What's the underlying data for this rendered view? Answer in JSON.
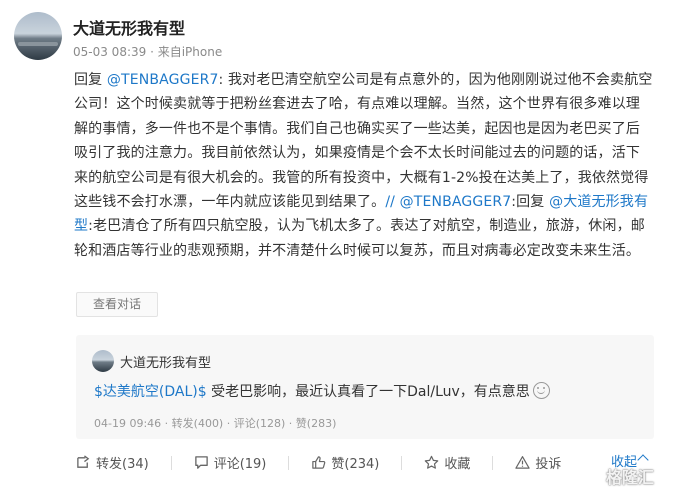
{
  "post": {
    "author": "大道无形我有型",
    "meta": "05-03 08:39 · 来自iPhone",
    "body": {
      "reply_prefix": "回复 ",
      "mention1": "@TENBAGGER7",
      "text1": ": 我对老巴清空航空公司是有点意外的，因为他刚刚说过他不会卖航空公司！这个时候卖就等于把粉丝套进去了哈，有点难以理解。当然，这个世界有很多难以理解的事情，多一件也不是个事情。我们自己也确实买了一些达美，起因也是因为老巴买了后吸引了我的注意力。我目前依然认为，如果疫情是个会不太长时间能过去的问题的话，活下来的航空公司是有很大机会的。我管的所有投资中，大概有1-2%投在达美上了，我依然觉得这些钱不会打水漂，一年内就应该能见到结果了。",
      "mention2": "// @TENBAGGER7",
      "text2": ":回复 ",
      "mention3": "@大道无形我有型",
      "text3": ":老巴清仓了所有四只航空股，认为飞机太多了。表达了对航空，制造业，旅游，休闲，邮轮和酒店等行业的悲观预期，并不清楚什么时候可以复苏，而且对病毒必定改变未来生活。"
    },
    "view_conversation": "查看对话"
  },
  "quote": {
    "author": "大道无形我有型",
    "stock_tag": "$达美航空(DAL)$",
    "text": " 受老巴影响，最近认真看了一下Dal/Luv，有点意思",
    "emoji_icon": "smile-icon",
    "meta": "04-19 09:46 · 转发(400) · 评论(128) · 赞(283)"
  },
  "actions": {
    "repost": "转发(34)",
    "comment": "评论(19)",
    "like": "赞(234)",
    "favorite": "收藏",
    "report": "投诉",
    "collapse": "收起"
  },
  "watermark": "格隆汇",
  "colors": {
    "link": "#1e78c8",
    "text": "#333333",
    "muted": "#8a8a8a",
    "card_bg": "#f7f7f7"
  }
}
